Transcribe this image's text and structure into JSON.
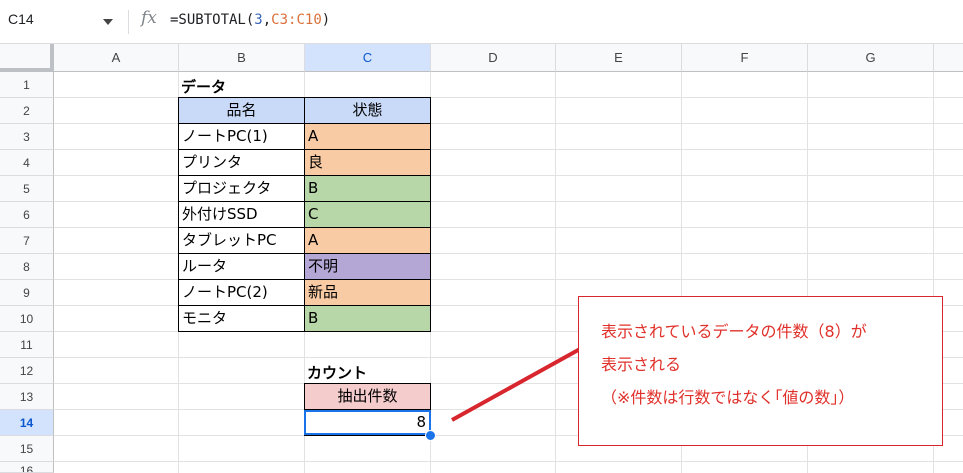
{
  "formula_bar": {
    "name_box": "C14",
    "fx_label": "fx",
    "formula_prefix": "=SUBTOTAL(",
    "formula_num": "3",
    "formula_comma": ",",
    "formula_ref": "C3:C10",
    "formula_suffix": ")"
  },
  "columns": [
    "A",
    "B",
    "C",
    "D",
    "E",
    "F",
    "G"
  ],
  "rows": [
    "1",
    "2",
    "3",
    "4",
    "5",
    "6",
    "7",
    "8",
    "9",
    "10",
    "11",
    "12",
    "13",
    "14",
    "15",
    "16"
  ],
  "sheet": {
    "data_title": "データ",
    "header_item": "品名",
    "header_status": "状態",
    "items": [
      {
        "name": "ノートPC(1)",
        "status": "A",
        "color": "#f8cba4"
      },
      {
        "name": "プリンタ",
        "status": "良",
        "color": "#f8cba4"
      },
      {
        "name": "プロジェクタ",
        "status": "B",
        "color": "#b7d7a8"
      },
      {
        "name": "外付けSSD",
        "status": "C",
        "color": "#b7d7a8"
      },
      {
        "name": "タブレットPC",
        "status": "A",
        "color": "#f8cba4"
      },
      {
        "name": "ルータ",
        "status": "不明",
        "color": "#b4a7d6"
      },
      {
        "name": "ノートPC(2)",
        "status": "新品",
        "color": "#f8cba4"
      },
      {
        "name": "モニタ",
        "status": "B",
        "color": "#b7d7a8"
      }
    ],
    "count_title": "カウント",
    "count_header": "抽出件数",
    "count_value": "8"
  },
  "callout": {
    "line1": "表示されているデータの件数（8）が",
    "line2": "表示される",
    "line3": "（※件数は行数ではなく｢値の数｣）"
  },
  "colors": {
    "header_blue": "#c9daf8",
    "count_header_pink": "#f4cccc",
    "selection": "#1a73e8",
    "callout_red": "#e0302a"
  }
}
